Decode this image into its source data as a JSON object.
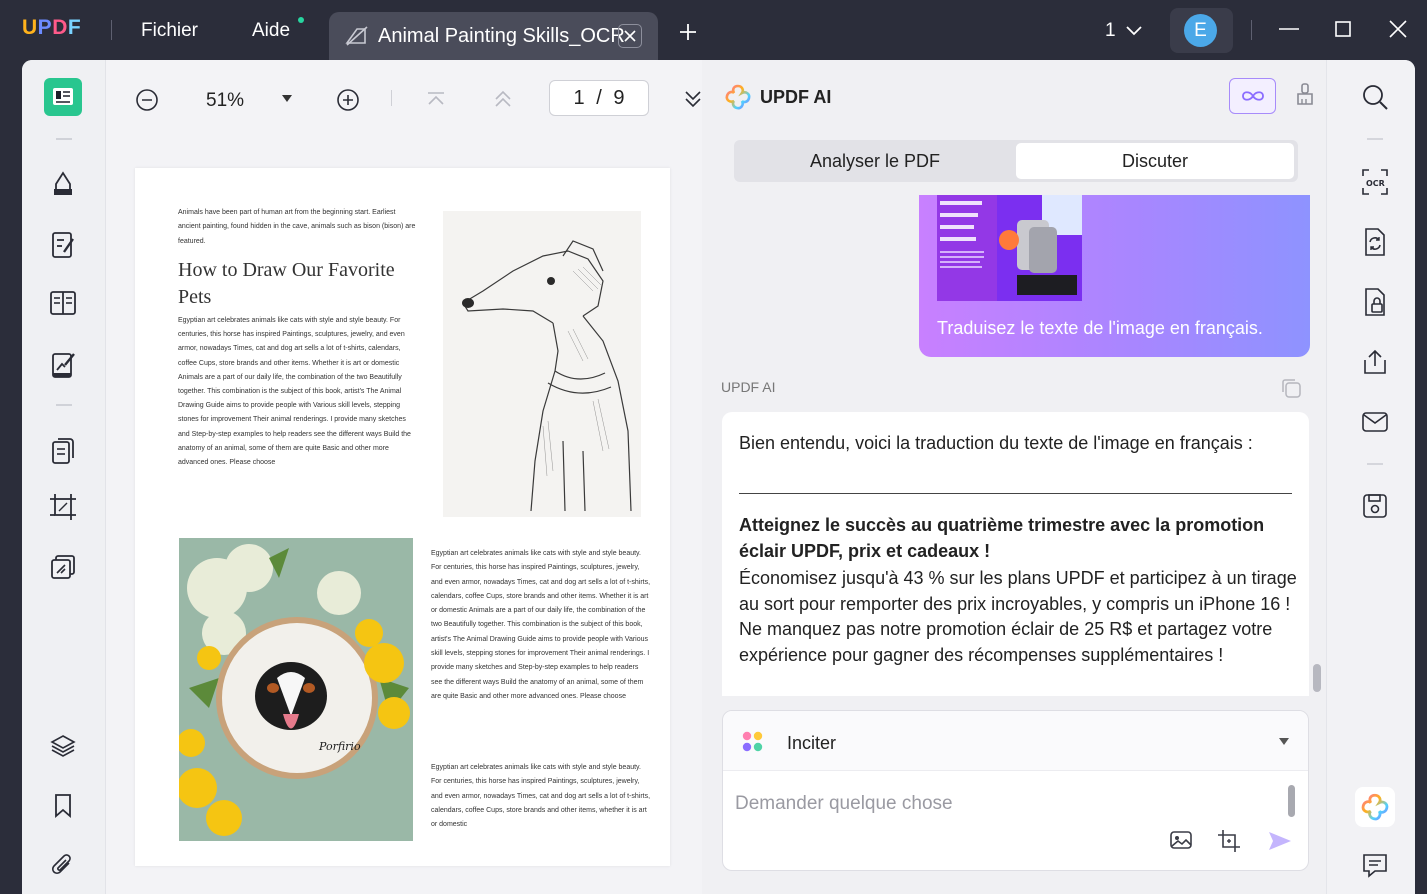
{
  "app": {
    "logo": "UPDF",
    "menus": [
      "Fichier",
      "Aide"
    ],
    "tab_title": "Animal Painting Skills_OCR",
    "page_selector": "1",
    "user_initial": "E"
  },
  "toolbar": {
    "zoom": "51%",
    "page_indicator": "1 / 9"
  },
  "document": {
    "intro": "Animals have been part of human art from the beginning start. Earliest ancient painting, found hidden in the cave, animals such as bison (bison) are featured.",
    "title": "How to Draw Our Favorite Pets",
    "body1": "Egyptian art celebrates animals like cats with style and style beauty. For centuries, this horse has inspired Paintings, sculptures, jewelry, and even armor, nowadays Times, cat and dog art sells a lot of t-shirts, calendars, coffee Cups, store brands and other items. Whether it is art or domestic Animals are a part of our daily life, the combination of the two Beautifully together. This combination is the subject of this book, artist's The Animal Drawing Guide aims to provide people with Various skill levels, stepping stones for improvement Their animal renderings. I provide many sketches and Step-by-step examples to help readers see the different ways Build the anatomy of an animal, some of them are quite Basic and other more advanced ones. Please choose",
    "body2": "Egyptian art celebrates animals like cats with style and style beauty. For centuries, this horse has inspired Paintings, sculptures, jewelry, and even armor, nowadays Times, cat and dog art sells a lot of t-shirts, calendars, coffee Cups, store brands and other items. Whether it is art or domestic Animals are a part of our daily life, the combination of the two Beautifully together. This combination is the subject of this book, artist's The Animal Drawing Guide aims to provide people with Various skill levels, stepping stones for improvement Their animal renderings. I provide many sketches and Step-by-step examples to help readers see the different ways Build the anatomy of an animal, some of them are quite Basic and other more advanced ones. Please choose",
    "body3": "Egyptian art celebrates animals like cats with style and style beauty. For centuries, this horse has inspired Paintings, sculptures, jewelry, and even armor, nowadays Times, cat and dog art sells a lot of t-shirts, calendars, coffee Cups, store brands and other items, whether it is art or domestic",
    "embroidery_signature": "Porfirio"
  },
  "ai": {
    "title": "UPDF AI",
    "tab_analyze": "Analyser le PDF",
    "tab_chat": "Discuter",
    "user_message": "Traduisez le texte de l'image en français.",
    "assistant_label": "UPDF AI",
    "response_intro": "Bien entendu, voici la traduction du texte de l'image en français :",
    "response_bold": "Atteignez le succès au quatrième trimestre avec la promotion éclair UPDF, prix et cadeaux !",
    "response_body": "Économisez jusqu'à 43 % sur les plans UPDF et participez à un tirage au sort pour remporter des prix incroyables, y compris un iPhone 16 ! Ne manquez pas notre promotion éclair de 25 R$ et partagez votre expérience pour gagner des récompenses supplémentaires !",
    "prompt_label": "Inciter",
    "input_placeholder": "Demander quelque chose"
  },
  "colors": {
    "accent_green": "#29c68f",
    "accent_purple": "#a886ff",
    "titlebar": "#2b2d3a"
  }
}
